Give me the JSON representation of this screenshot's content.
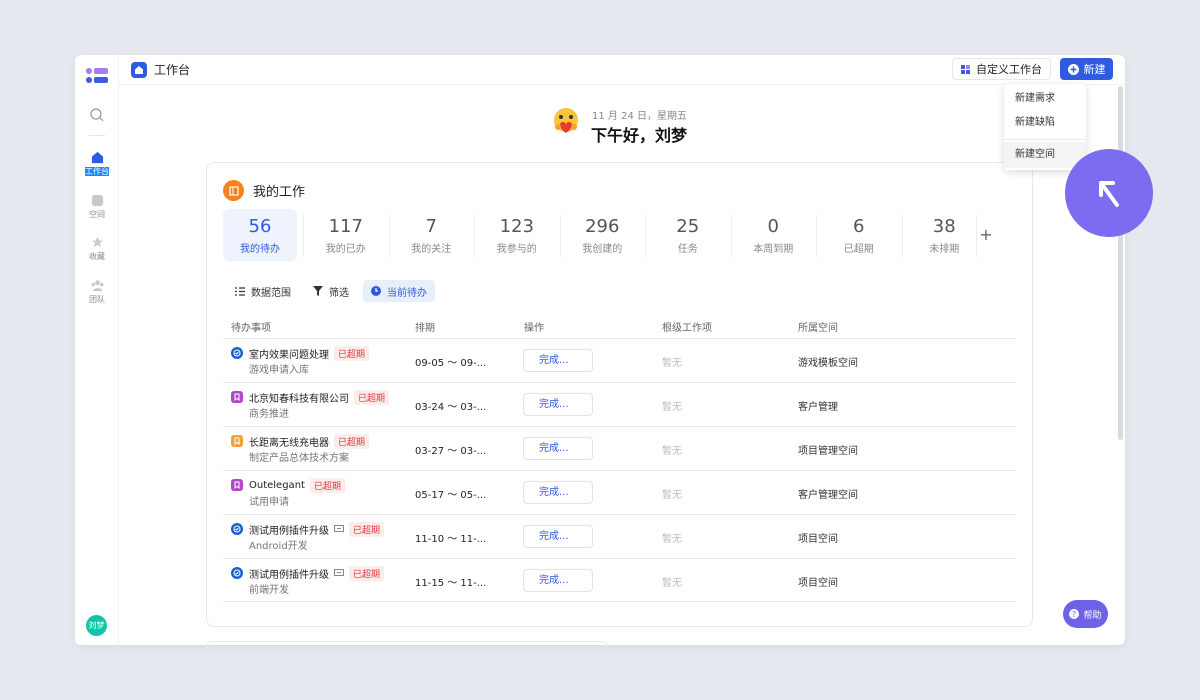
{
  "header": {
    "title": "工作台",
    "customize_label": "自定义工作台",
    "new_label": "新建"
  },
  "new_menu": [
    "新建需求",
    "新建缺陷",
    "新建空间"
  ],
  "sidebar": {
    "items": [
      {
        "label": "工作台"
      },
      {
        "label": "空间"
      },
      {
        "label": "收藏"
      },
      {
        "label": "团队"
      }
    ],
    "avatar": "刘梦"
  },
  "greeting": {
    "date": "11 月 24 日，星期五",
    "text": "下午好，刘梦"
  },
  "work": {
    "title": "我的工作",
    "stats": [
      {
        "n": "56",
        "l": "我的待办"
      },
      {
        "n": "117",
        "l": "我的已办"
      },
      {
        "n": "7",
        "l": "我的关注"
      },
      {
        "n": "123",
        "l": "我参与的"
      },
      {
        "n": "296",
        "l": "我创建的"
      },
      {
        "n": "25",
        "l": "任务"
      },
      {
        "n": "0",
        "l": "本周到期"
      },
      {
        "n": "6",
        "l": "已超期"
      },
      {
        "n": "38",
        "l": "未排期"
      }
    ],
    "add": "+",
    "filters": [
      "数据范围",
      "筛选",
      "当前待办"
    ],
    "columns": [
      "待办事项",
      "排期",
      "操作",
      "根级工作项",
      "所属空间"
    ],
    "rows": [
      {
        "name": "室内效果问题处理",
        "tag": "已超期",
        "sub": "游戏申请入库",
        "date": "09-05 ～ 09-...",
        "action": "完成...",
        "root": "暂无",
        "space": "游戏模板空间"
      },
      {
        "name": "北京知春科技有限公司",
        "tag": "已超期",
        "sub": "商务推进",
        "date": "03-24 ～ 03-...",
        "action": "完成...",
        "root": "暂无",
        "space": "客户管理"
      },
      {
        "name": "长距离无线充电器",
        "tag": "已超期",
        "sub": "制定产品总体技术方案",
        "date": "03-27 ～ 03-...",
        "action": "完成...",
        "root": "暂无",
        "space": "项目管理空间"
      },
      {
        "name": "Outelegant",
        "tag": "已超期",
        "sub": "试用申请",
        "date": "05-17 ～ 05-...",
        "action": "完成...",
        "root": "暂无",
        "space": "客户管理空间"
      },
      {
        "name": "测试用例插件升级",
        "tag": "已超期",
        "sub": "Android开发",
        "date": "11-10 ～ 11-...",
        "action": "完成...",
        "root": "暂无",
        "space": "项目空间"
      },
      {
        "name": "测试用例插件升级",
        "tag": "已超期",
        "sub": "前端开发",
        "date": "11-15 ～ 11-...",
        "action": "完成...",
        "root": "暂无",
        "space": "项目空间"
      }
    ]
  },
  "help_label": "帮助",
  "colors": {
    "primary": "#2f5be0",
    "overdue": "#e0383e",
    "cursor": "#7b6cf0"
  }
}
